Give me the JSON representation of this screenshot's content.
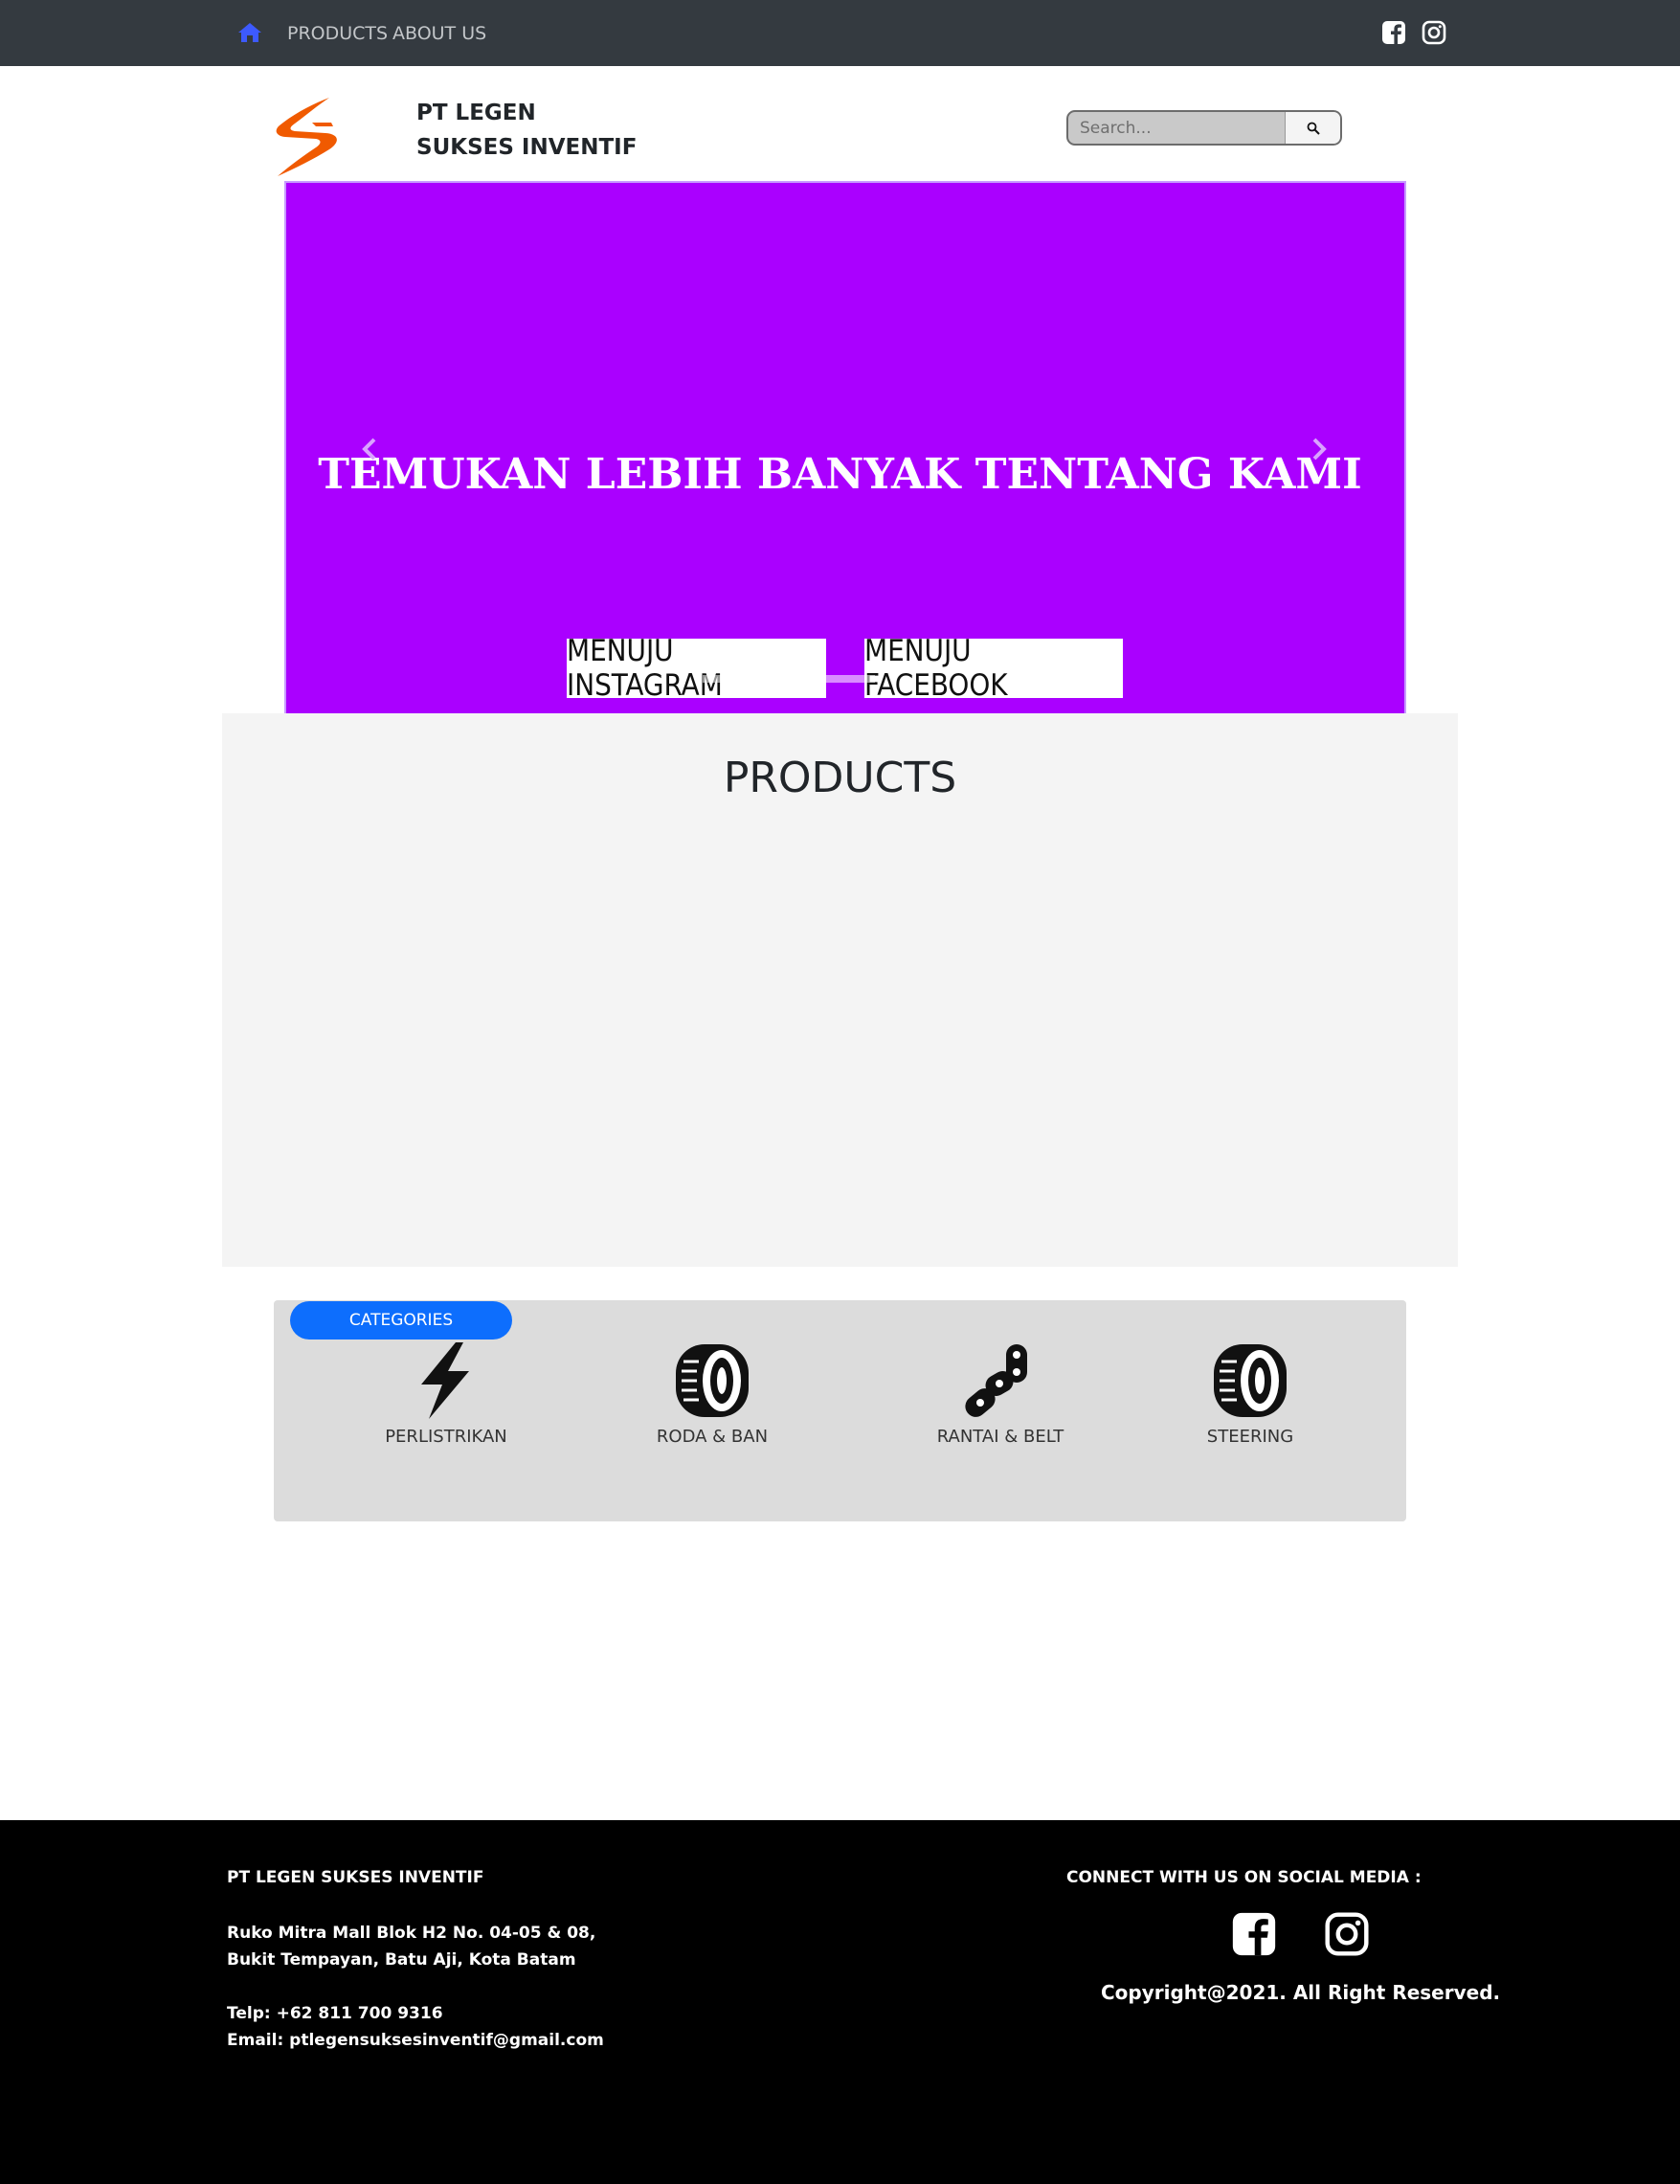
{
  "navbar": {
    "home_icon": "home-icon",
    "items": [
      {
        "label": "PRODUCTS"
      },
      {
        "label": "ABOUT US"
      }
    ],
    "social_icons": [
      "facebook-icon",
      "instagram-icon"
    ]
  },
  "header": {
    "brand_line1": "PT LEGEN",
    "brand_line2": "SUKSES INVENTIF",
    "search_placeholder": "Search..."
  },
  "hero": {
    "title": "TEMUKAN LEBIH BANYAK TENTANG KAMI",
    "buttons": [
      {
        "label": "MENUJU INSTAGRAM"
      },
      {
        "label": "MENUJU FACEBOOK"
      }
    ],
    "background_color": "#aa00ff"
  },
  "products": {
    "title": "PRODUCTS"
  },
  "categories": {
    "badge": "CATEGORIES",
    "items": [
      {
        "label": "PERLISTRIKAN",
        "icon": "lightning-icon"
      },
      {
        "label": "RODA & BAN",
        "icon": "tire-icon"
      },
      {
        "label": "RANTAI & BELT",
        "icon": "chain-icon"
      },
      {
        "label": "STEERING",
        "icon": "tire-icon"
      }
    ]
  },
  "footer": {
    "company": "PT LEGEN SUKSES INVENTIF",
    "address_line1": "Ruko Mitra Mall Blok H2 No. 04-05 & 08,",
    "address_line2": "Bukit Tempayan, Batu Aji, Kota Batam",
    "phone": "Telp: +62 811 700 9316",
    "email": "Email: ptlegensuksesinventif@gmail.com",
    "connect": "CONNECT WITH US ON SOCIAL MEDIA :",
    "copyright": "Copyright@2021. All Right Reserved."
  },
  "colors": {
    "navbar_bg": "#343a40",
    "accent_blue": "#0d6efd",
    "hero_purple": "#aa00ff",
    "logo_orange": "#f05a00"
  }
}
